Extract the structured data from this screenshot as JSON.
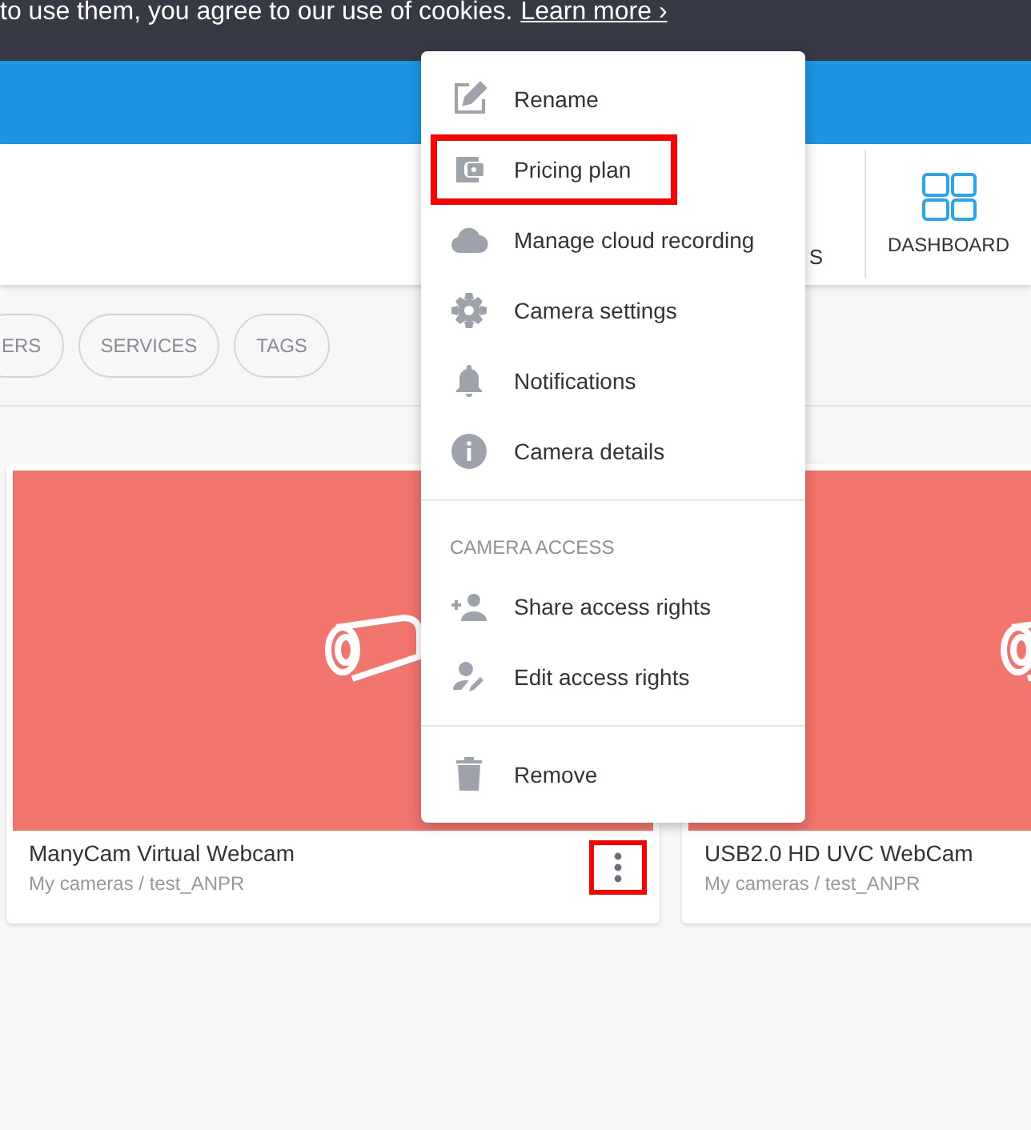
{
  "cookie_bar": {
    "text": "to use them, you agree to our use of cookies.",
    "link": "Learn more ›"
  },
  "nav": {
    "items": [
      {
        "label": "S",
        "kind": "text",
        "selected": false
      },
      {
        "label": "DASHBOARD",
        "kind": "dashboard",
        "selected": false
      }
    ]
  },
  "filters": [
    {
      "label": "ERS"
    },
    {
      "label": "SERVICES"
    },
    {
      "label": "TAGS"
    }
  ],
  "cameras": [
    {
      "name": "ManyCam Virtual Webcam",
      "path": "My cameras / test_ANPR",
      "online": false,
      "menu_highlighted": true
    },
    {
      "name": "USB2.0 HD UVC WebCam",
      "path": "My cameras / test_ANPR",
      "online": false
    }
  ],
  "context_menu": {
    "sections": [
      {
        "items": [
          {
            "label": "Rename",
            "kind": "edit",
            "highlighted": false
          },
          {
            "label": "Pricing plan",
            "kind": "wallet",
            "highlighted": true
          },
          {
            "label": "Manage cloud recording",
            "kind": "cloud",
            "highlighted": false
          },
          {
            "label": "Camera settings",
            "kind": "gear",
            "highlighted": false
          },
          {
            "label": "Notifications",
            "kind": "bell",
            "highlighted": false
          },
          {
            "label": "Camera details",
            "kind": "info",
            "highlighted": false
          }
        ]
      },
      {
        "heading": "CAMERA ACCESS",
        "items": [
          {
            "label": "Share access rights",
            "kind": "person-add",
            "highlighted": false
          },
          {
            "label": "Edit access rights",
            "kind": "person-edit",
            "highlighted": false
          }
        ]
      },
      {
        "items": [
          {
            "label": "Remove",
            "kind": "trash",
            "highlighted": false
          }
        ]
      }
    ]
  }
}
